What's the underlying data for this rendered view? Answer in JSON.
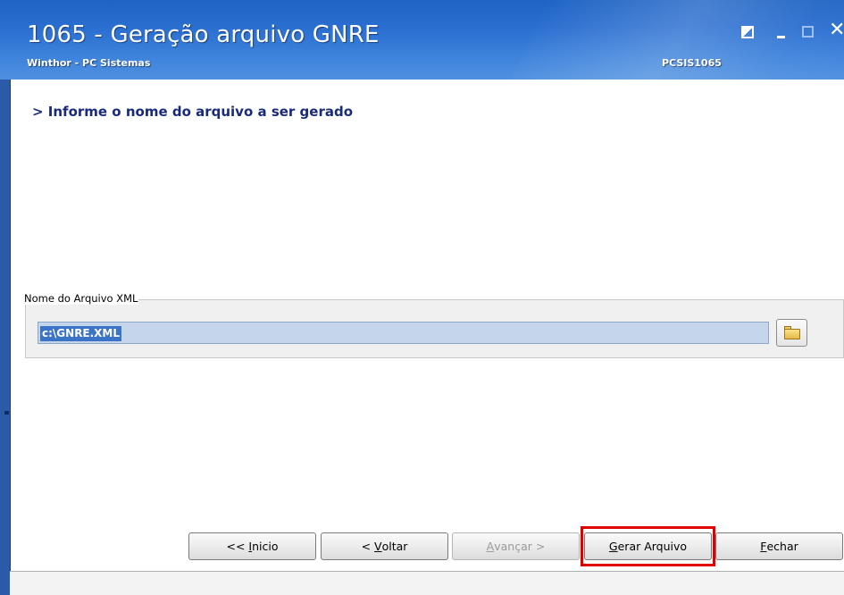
{
  "window": {
    "title": "1065 - Geração arquivo GNRE",
    "subtitle": "Winthor - PC Sistemas",
    "code": "PCSIS1065",
    "close_glyph": "✕"
  },
  "content": {
    "instruction": "> Informe o nome do arquivo a ser gerado"
  },
  "file_group": {
    "label": "Nome do Arquivo XML",
    "value": "c:\\GNRE.XML",
    "browse_icon": "folder-open-icon"
  },
  "buttons": {
    "inicio": {
      "prefix": "<< ",
      "mnemonic": "I",
      "rest": "nicio"
    },
    "voltar": {
      "prefix": "< ",
      "mnemonic": "V",
      "rest": "oltar"
    },
    "avancar": {
      "mnemonic": "A",
      "rest": "vançar >"
    },
    "gerar": {
      "mnemonic": "G",
      "rest": "erar Arquivo"
    },
    "fechar": {
      "mnemonic": "F",
      "rest": "echar"
    }
  },
  "colors": {
    "title_bar": "#2a6ed0",
    "instruction_text": "#1a2a7a",
    "selection": "#3b73c6",
    "highlight_box": "#e00000"
  }
}
